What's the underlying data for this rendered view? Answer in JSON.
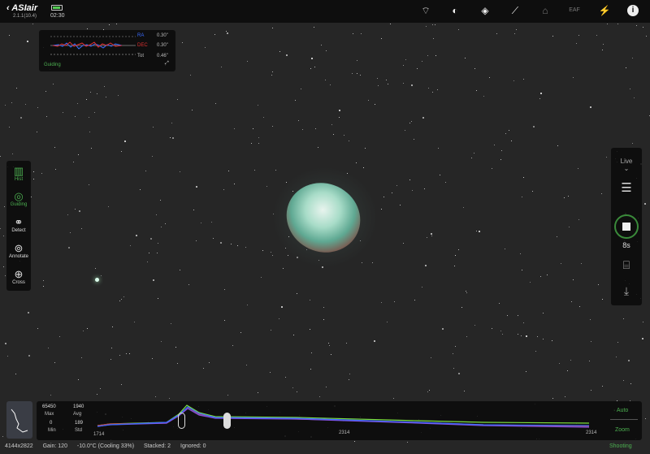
{
  "app": {
    "brand": "ASIair",
    "version": "2.1.1(10.4)",
    "time": "02:30",
    "battery_level": 0.7
  },
  "top_icons": [
    "wifi-icon",
    "storage-icon",
    "focus-target-icon",
    "telescope-icon",
    "observatory-icon",
    "eaf-icon",
    "usb-power-icon",
    "info-icon"
  ],
  "guiding": {
    "ra_label": "RA",
    "ra_value": "0.30\"",
    "dec_label": "DEC",
    "dec_value": "0.30\"",
    "tot_label": "Tot",
    "tot_value": "0.46\"",
    "status": "Guiding",
    "colors": {
      "ra": "#3a6cff",
      "dec": "#e03030"
    }
  },
  "left_tools": [
    {
      "label": "Hist",
      "icon": "histogram-icon",
      "active": true
    },
    {
      "label": "Guiding",
      "icon": "guiding-icon",
      "active": true
    },
    {
      "label": "Detect",
      "icon": "detect-icon"
    },
    {
      "label": "Annotate",
      "icon": "annotate-icon"
    },
    {
      "label": "Cross",
      "icon": "crosshair-icon"
    }
  ],
  "right_panel": {
    "mode": "Live",
    "exposure": "8s"
  },
  "histogram": {
    "max": "65450",
    "max_label": "Max",
    "avg": "1940",
    "avg_label": "Avg",
    "min": "0",
    "min_label": "Min",
    "std": "189",
    "std_label": "Std",
    "x_left": "1714",
    "x_mid": "2314",
    "x_right": "2314",
    "auto": "Auto",
    "zoom": "Zoom"
  },
  "status": {
    "resolution": "4144x2822",
    "gain": "Gain: 120",
    "temp": "-10.0°C (Cooling 33%)",
    "stacked": "Stacked: 2",
    "ignored": "Ignored: 0",
    "state": "Shooting"
  },
  "colors": {
    "accent": "#4caf50"
  }
}
